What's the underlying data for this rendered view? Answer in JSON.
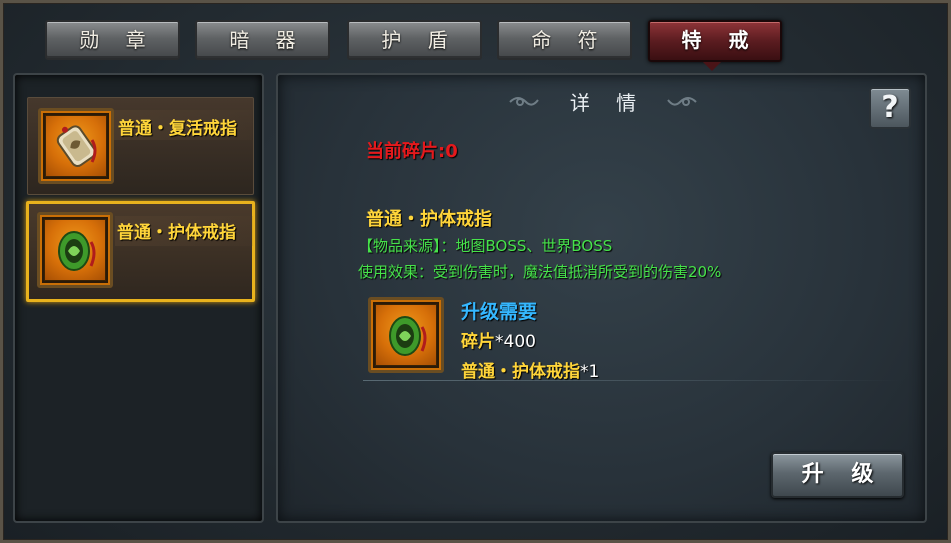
{
  "tabs": [
    {
      "label": "勋 章",
      "active": false
    },
    {
      "label": "暗 器",
      "active": false
    },
    {
      "label": "护 盾",
      "active": false
    },
    {
      "label": "命 符",
      "active": false
    },
    {
      "label": "特 戒",
      "active": true
    }
  ],
  "item_list": [
    {
      "label": "普通・复活戒指",
      "icon": "revive-ring-icon",
      "selected": false
    },
    {
      "label": "普通・护体戒指",
      "icon": "guard-ring-icon",
      "selected": true
    }
  ],
  "detail": {
    "header": "详 情",
    "help_label": "?",
    "current_fragments": "当前碎片:0",
    "item_name": "普通・护体戒指",
    "source": "【物品来源】：地图BOSS、世界BOSS",
    "effect": "使用效果：受到伤害时，魔法值抵消所受到的伤害20%",
    "requirement": {
      "title": "升级需要",
      "lines": [
        {
          "name": "碎片",
          "qty": "*400"
        },
        {
          "name": "普通・护体戒指",
          "qty": "*1"
        }
      ]
    },
    "upgrade_label": "升 级"
  },
  "colors": {
    "tab_active": "#5b1c20",
    "selected_border": "#e8b21d",
    "item_gold": "#ffd53a",
    "fragment_red": "#e5191c",
    "info_green": "#46e24a",
    "req_blue": "#35b7ff"
  }
}
